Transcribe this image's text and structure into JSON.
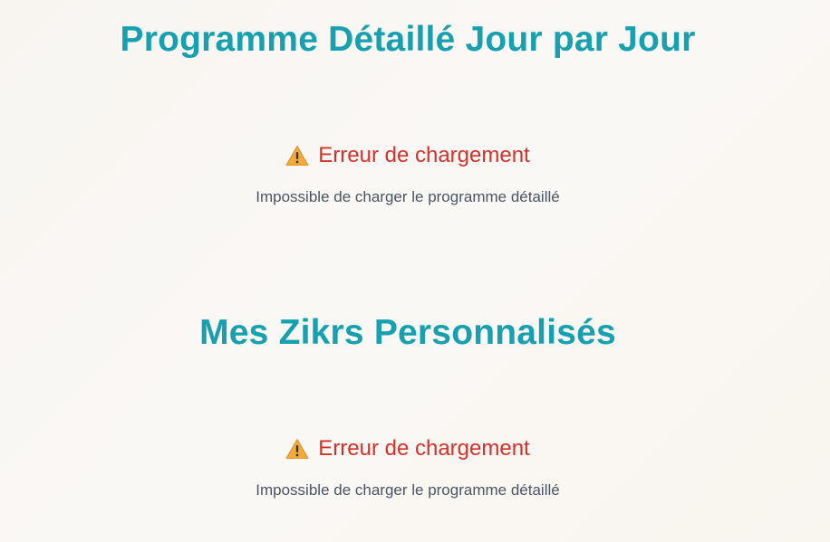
{
  "sections": [
    {
      "title": "Programme Détaillé Jour par Jour",
      "error": {
        "icon": "warning-icon",
        "heading": "Erreur de chargement",
        "message": "Impossible de charger le programme détaillé"
      }
    },
    {
      "title": "Mes Zikrs Personnalisés",
      "error": {
        "icon": "warning-icon",
        "heading": "Erreur de chargement",
        "message": "Impossible de charger le programme détaillé"
      }
    }
  ],
  "colors": {
    "title": "#17a0b0",
    "error_heading": "#d6302a",
    "error_message": "#4a5563",
    "warning_fill": "#f4a93b"
  }
}
